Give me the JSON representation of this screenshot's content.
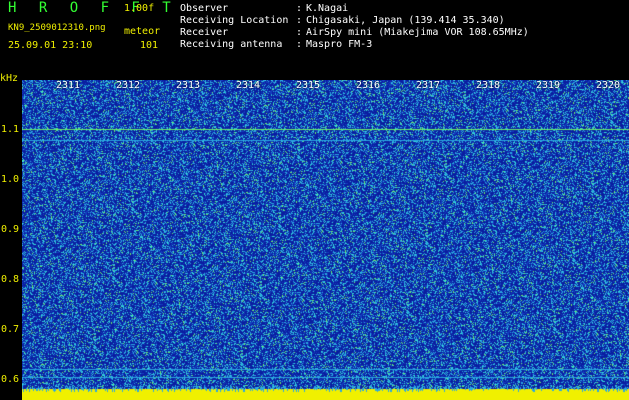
{
  "header": {
    "brand": "H R O F F T",
    "version": "1.00f",
    "filename": "KN9_2509012310.png",
    "mode": "meteor",
    "datetime": "25.09.01 23:10",
    "count": "101"
  },
  "info": [
    {
      "label": "Observer",
      "value": "K.Nagai"
    },
    {
      "label": "Receiving Location",
      "value": "Chigasaki, Japan (139.414 35.340)"
    },
    {
      "label": "Receiver",
      "value": "AirSpy mini (Miakejima VOR 108.65MHz)"
    },
    {
      "label": "Receiving antenna",
      "value": "Maspro FM-3"
    }
  ],
  "axis": {
    "unit": "kHz",
    "y_ticks": [
      "1.1",
      "1.0",
      "0.9",
      "0.8",
      "0.7",
      "0.6"
    ],
    "time_ticks": [
      "2311",
      "2312",
      "2313",
      "2314",
      "2315",
      "2316",
      "2317",
      "2318",
      "2319",
      "2320"
    ]
  },
  "colors": {
    "background": "#000000",
    "spectrogram_base": "#0a1ea0",
    "noise_light": "#2aa8e0",
    "noise_cyan": "#36e0d8",
    "noise_green": "#6cf06c",
    "label_yellow": "#f0f000",
    "brand_green": "#33ff33",
    "strip_yellow": "#f0f000"
  },
  "colon": ":"
}
